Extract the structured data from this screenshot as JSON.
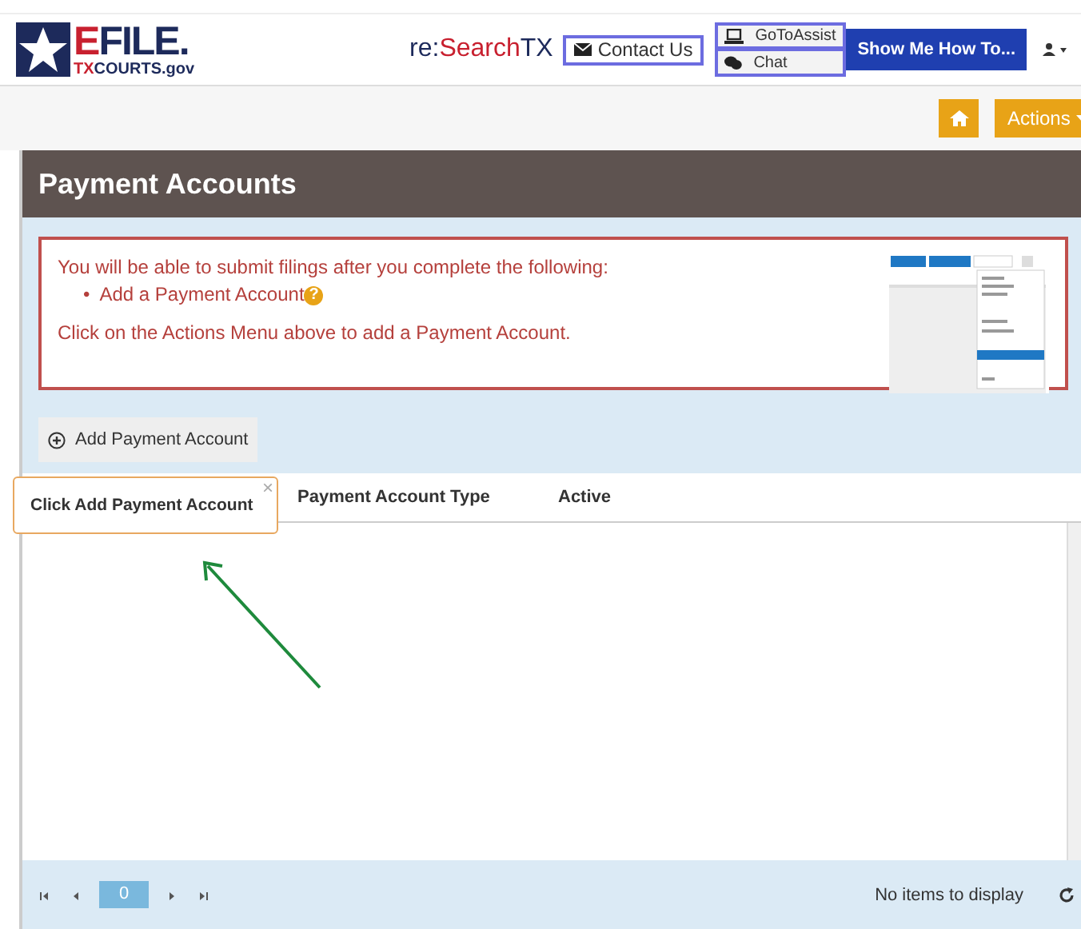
{
  "header": {
    "logo": {
      "parts": [
        {
          "text": "E",
          "kind": "accent"
        },
        {
          "text": "FILE.",
          "kind": "plain"
        }
      ],
      "sub_parts": [
        {
          "text": "TX",
          "kind": "accent"
        },
        {
          "text": "COURTS.gov",
          "kind": "plain"
        }
      ]
    },
    "brand": {
      "parts": [
        {
          "text": "re:",
          "kind": "plain"
        },
        {
          "text": "Search",
          "kind": "accent"
        },
        {
          "text": "TX",
          "kind": "plain"
        }
      ]
    },
    "contact": {
      "label": "Contact Us"
    },
    "assist": [
      {
        "label": "GoToAssist",
        "kind": "laptop"
      },
      {
        "label": "Chat",
        "kind": "chat"
      }
    ],
    "show_me": {
      "label": "Show Me How To..."
    }
  },
  "toolbar": {
    "actions": {
      "label": "Actions"
    }
  },
  "page": {
    "title": "Payment Accounts"
  },
  "alert": {
    "intro": "You will be able to submit filings after you complete the following:",
    "items": [
      {
        "bullet": "•",
        "text": "Add a Payment Account",
        "help": "?"
      }
    ],
    "outro": "Click on the Actions Menu above to add a Payment Account."
  },
  "add_button": {
    "label": "Add Payment Account"
  },
  "tooltip": {
    "text": "Click Add Payment Account",
    "close": "×"
  },
  "table": {
    "columns": [
      "Payment Account Type",
      "Active"
    ]
  },
  "pager": {
    "page": "0",
    "status": "No items to display"
  }
}
